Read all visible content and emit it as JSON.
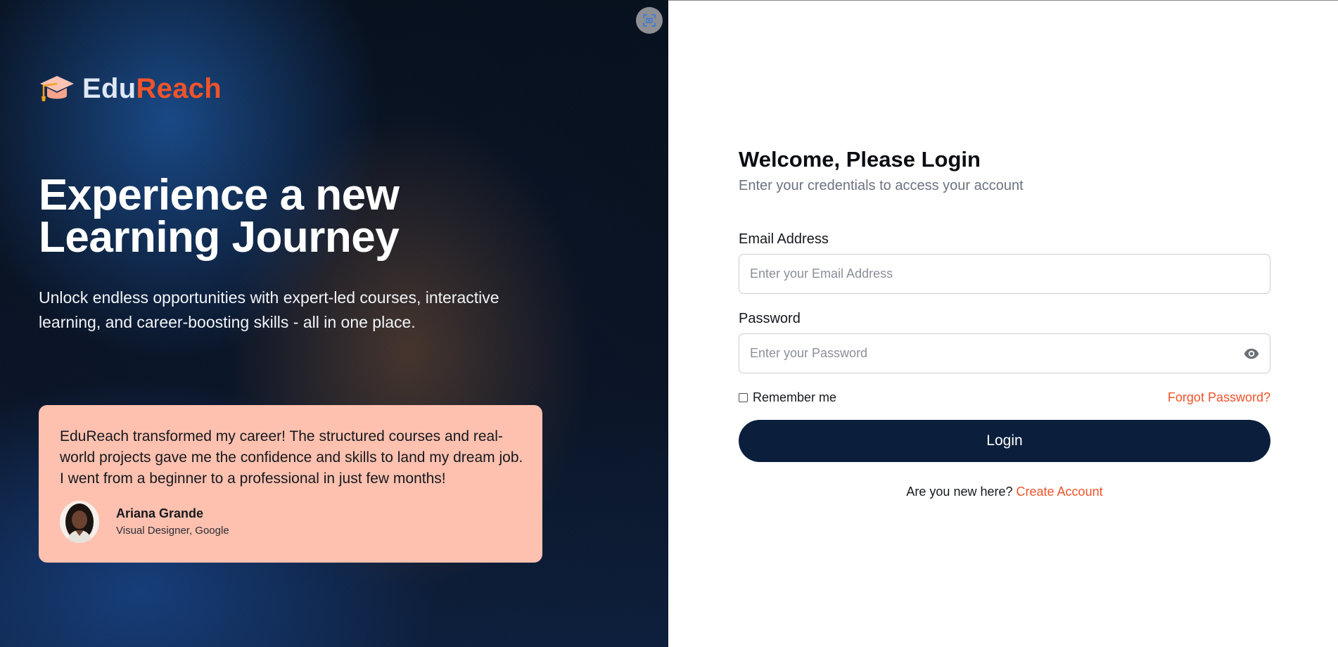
{
  "brand": {
    "name_part1": "Edu",
    "name_part2": "Reach",
    "icon": "graduation-cap-icon",
    "accent_color": "#f0532a"
  },
  "hero": {
    "title_line1": "Experience a new",
    "title_line2": "Learning Journey",
    "subtitle": "Unlock endless opportunities with expert-led courses, interactive learning, and career-boosting skills - all in one place."
  },
  "testimonial": {
    "quote": "EduReach transformed my career! The structured courses and real-world projects gave me the confidence and skills to land my dream job. I went from a beginner to a professional in just few months!",
    "author_name": "Ariana Grande",
    "author_role": "Visual Designer, Google",
    "background_color": "#fec1b0"
  },
  "screenshot_tool": {
    "icon": "screenshot-capture-icon"
  },
  "login": {
    "title": "Welcome, Please Login",
    "subtitle": "Enter your credentials to access your account",
    "email_label": "Email Address",
    "email_placeholder": "Enter your Email Address",
    "email_value": "",
    "password_label": "Password",
    "password_placeholder": "Enter your Password",
    "password_value": "",
    "password_toggle_icon": "eye-icon",
    "remember_label": "Remember me",
    "remember_checked": false,
    "forgot_label": "Forgot Password?",
    "button_label": "Login",
    "button_color": "#0b1f3d",
    "new_here_text": "Are you new here?",
    "create_account_label": "Create Account"
  }
}
